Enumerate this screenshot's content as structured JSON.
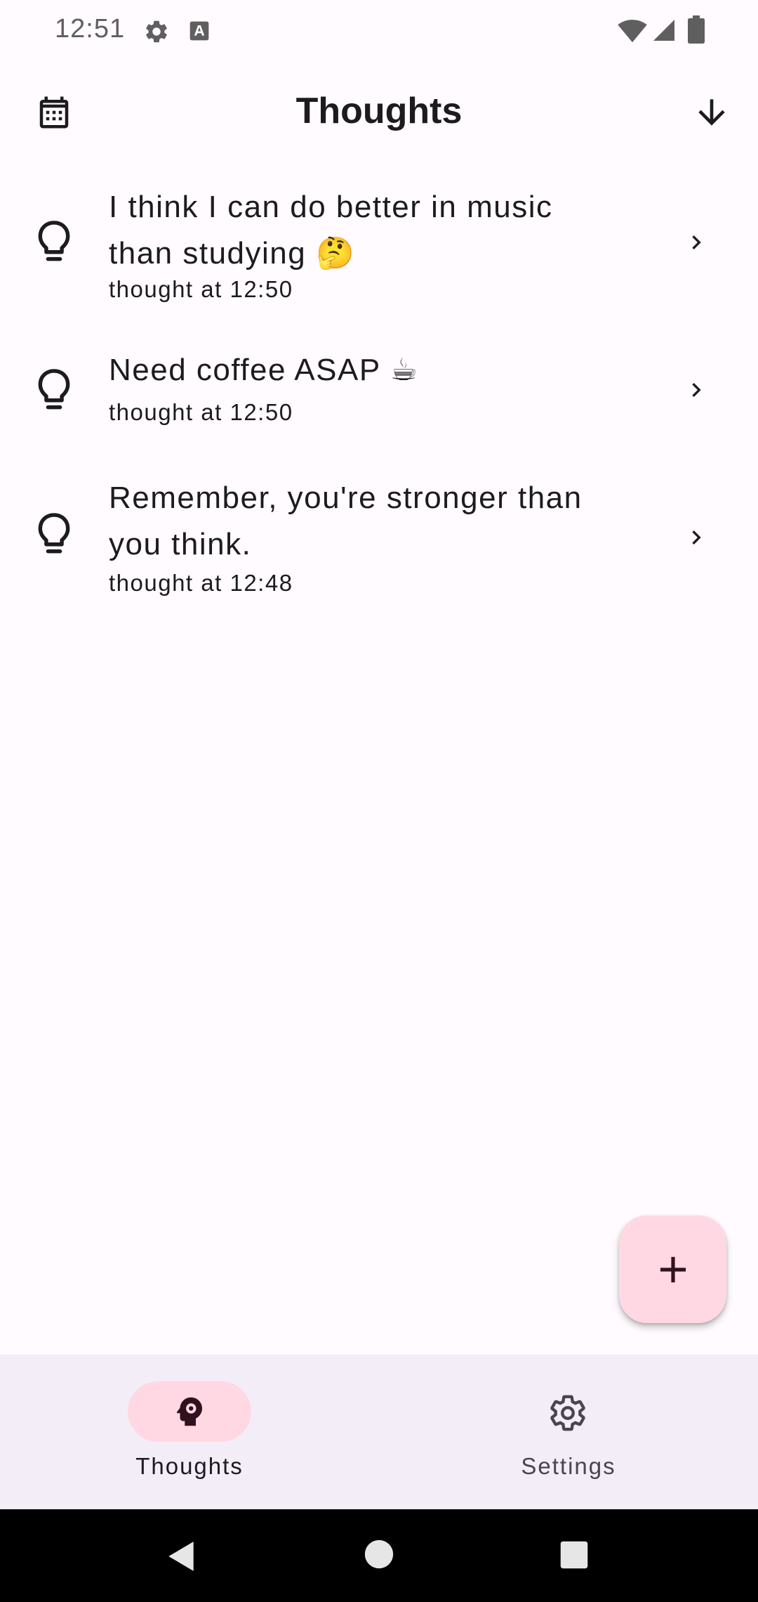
{
  "status_bar": {
    "time": "12:51",
    "icons": [
      "gear-icon",
      "keyboard-a-icon",
      "wifi-icon",
      "cellular-signal-icon",
      "battery-icon"
    ]
  },
  "app_bar": {
    "title": "Thoughts",
    "left_icon": "calendar-icon",
    "right_icon": "arrow-down-icon"
  },
  "thoughts": [
    {
      "line1": "I think I can do better in music",
      "line2": "than studying 🤔",
      "time": "thought at 12:50",
      "icon": "lightbulb-icon"
    },
    {
      "line1": "Need coffee ASAP ☕",
      "line2": "",
      "time": "thought at 12:50",
      "icon": "lightbulb-icon"
    },
    {
      "line1": "Remember, you're stronger than",
      "line2": "you think.",
      "time": "thought at 12:48",
      "icon": "lightbulb-icon"
    }
  ],
  "fab": {
    "icon": "plus-icon"
  },
  "bottom_nav": {
    "items": [
      {
        "label": "Thoughts",
        "icon": "head-gear-icon",
        "selected": true
      },
      {
        "label": "Settings",
        "icon": "settings-gear-icon",
        "selected": false
      }
    ]
  },
  "system_nav": {
    "icons": [
      "back-icon",
      "home-icon",
      "recents-icon"
    ]
  },
  "colors": {
    "background": "#FFFBFE",
    "nav_background": "#F3EDF7",
    "accent_container": "#FFD8E4",
    "on_surface": "#1C1B1F"
  }
}
